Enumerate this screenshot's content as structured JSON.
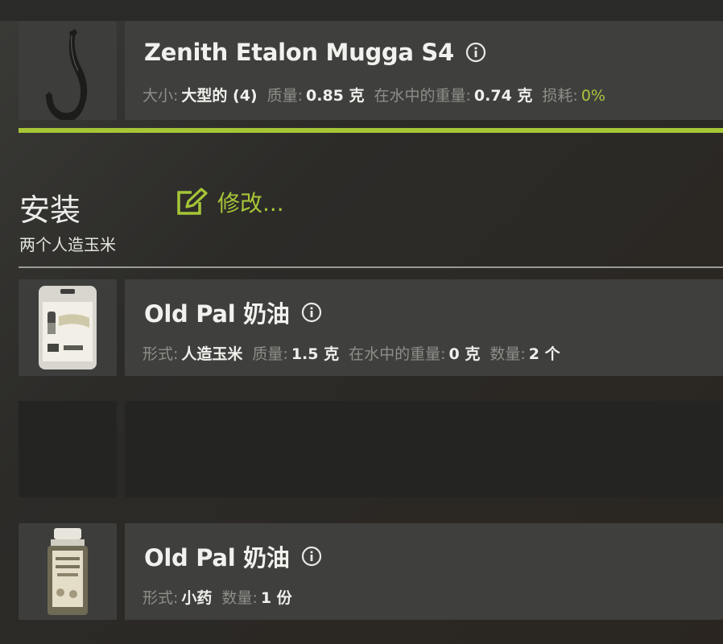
{
  "hook": {
    "name": "Zenith Etalon Mugga S4",
    "props": [
      {
        "label": "大小:",
        "value": "大型的 (4)"
      },
      {
        "label": "质量:",
        "value": "0.85 克"
      },
      {
        "label": "在水中的重量:",
        "value": "0.74 克"
      },
      {
        "label": "损耗:",
        "value": "0%",
        "accent": true
      }
    ]
  },
  "section": {
    "title": "安装",
    "subtitle": "两个人造玉米",
    "edit_label": "修改..."
  },
  "baits": [
    {
      "name": "Old Pal 奶油",
      "props": [
        {
          "label": "形式:",
          "value": "人造玉米"
        },
        {
          "label": "质量:",
          "value": "1.5 克"
        },
        {
          "label": "在水中的重量:",
          "value": "0 克"
        },
        {
          "label": "数量:",
          "value": "2 个"
        }
      ]
    },
    {
      "name": "Old Pal 奶油",
      "props": [
        {
          "label": "形式:",
          "value": "小药"
        },
        {
          "label": "数量:",
          "value": "1 份"
        }
      ]
    }
  ],
  "colors": {
    "accent": "#a6c637",
    "label": "#8e8e89",
    "card": "#3f3f3d"
  },
  "icons": [
    "hook-icon",
    "info-icon",
    "edit-icon",
    "corn-package-icon",
    "pellet-bottle-icon"
  ]
}
